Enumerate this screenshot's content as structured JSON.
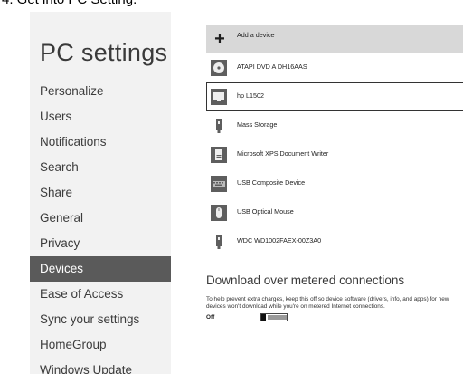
{
  "caption": "4. Get into PC Setting.",
  "sidebar": {
    "title": "PC settings",
    "items": [
      {
        "label": "Personalize"
      },
      {
        "label": "Users"
      },
      {
        "label": "Notifications"
      },
      {
        "label": "Search"
      },
      {
        "label": "Share"
      },
      {
        "label": "General"
      },
      {
        "label": "Privacy"
      },
      {
        "label": "Devices",
        "selected": true
      },
      {
        "label": "Ease of Access"
      },
      {
        "label": "Sync your settings"
      },
      {
        "label": "HomeGroup"
      },
      {
        "label": "Windows Update"
      }
    ]
  },
  "devices": {
    "add_label": "Add a device",
    "items": [
      {
        "label": "ATAPI DVD A  DH16AAS",
        "icon": "disc-drive-icon"
      },
      {
        "label": "hp L1502",
        "icon": "monitor-icon",
        "selected": true
      },
      {
        "label": "Mass Storage",
        "icon": "usb-drive-icon"
      },
      {
        "label": "Microsoft XPS Document Writer",
        "icon": "printer-icon"
      },
      {
        "label": "USB Composite Device",
        "icon": "keyboard-icon"
      },
      {
        "label": "USB Optical Mouse",
        "icon": "mouse-icon"
      },
      {
        "label": "WDC WD1002FAEX-00Z3A0",
        "icon": "usb-drive-icon"
      }
    ]
  },
  "metered": {
    "heading": "Download over metered connections",
    "description": "To help prevent extra charges, keep this off so device software (drivers, info, and apps) for new devices won't download while you're on metered Internet connections.",
    "toggle_label": "Off",
    "toggle_state": "off"
  },
  "colors": {
    "selected_nav_bg": "#5a5a5a",
    "sidebar_bg": "#f2f2f2",
    "add_device_bg": "#d8d8d8",
    "icon_tile": "#5e5e5e"
  }
}
